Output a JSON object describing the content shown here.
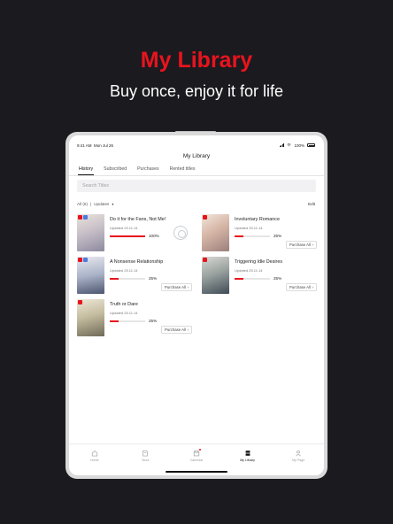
{
  "promo": {
    "title": "My Library",
    "subtitle": "Buy once, enjoy it for life"
  },
  "status_bar": {
    "time": "9:41 AM",
    "date": "Mon Jul 26",
    "battery": "100%"
  },
  "header": {
    "title": "My Library"
  },
  "tabs": [
    {
      "label": "History",
      "active": true
    },
    {
      "label": "Subscribed",
      "active": false
    },
    {
      "label": "Purchases",
      "active": false
    },
    {
      "label": "Rented titles",
      "active": false
    }
  ],
  "search": {
    "placeholder": "Search Titles"
  },
  "filter": {
    "all": "All (5)",
    "separator": "|",
    "sort": "Updates",
    "edit": "Edit"
  },
  "items": [
    {
      "title": "Do it for the Fans, Not Me!",
      "updated": "Updated 25.11.14",
      "progress": 100,
      "percent": "100%",
      "purchase_all": ""
    },
    {
      "title": "Involuntary Romance",
      "updated": "Updated 25.11.14",
      "progress": 25,
      "percent": "25%",
      "purchase_all": "Purchase All"
    },
    {
      "title": "A Nonsense Relationship",
      "updated": "Updated 25.11.14",
      "progress": 25,
      "percent": "25%",
      "purchase_all": "Purchase All"
    },
    {
      "title": "Triggering Idle Desires",
      "updated": "Updated 25.11.14",
      "progress": 25,
      "percent": "25%",
      "purchase_all": "Purchase All"
    },
    {
      "title": "Truth or Dare",
      "updated": "Updated 25.11.14",
      "progress": 25,
      "percent": "25%",
      "purchase_all": "Purchase All"
    }
  ],
  "tabbar": [
    {
      "label": "Home",
      "icon": "home-icon",
      "active": false
    },
    {
      "label": "Store",
      "icon": "store-icon",
      "active": false
    },
    {
      "label": "Calendar",
      "icon": "calendar-icon",
      "active": false
    },
    {
      "label": "My Library",
      "icon": "library-icon",
      "active": true
    },
    {
      "label": "My Page",
      "icon": "person-icon",
      "active": false
    }
  ],
  "colors": {
    "accent": "#e8141d",
    "background": "#1b1a1f"
  }
}
